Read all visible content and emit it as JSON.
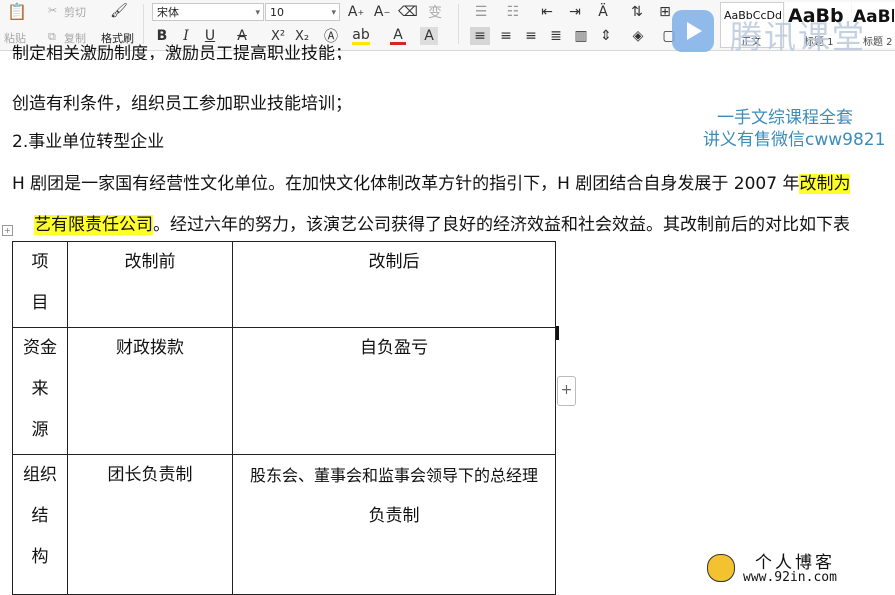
{
  "ribbon": {
    "paste_label": "粘贴",
    "cut_label": "剪切",
    "copy_label": "复制",
    "format_painter_label": "格式刷",
    "font_name": "宋体",
    "font_size": "10",
    "bold": "B",
    "italic": "I",
    "underline": "U",
    "strikethrough": "A",
    "superscript": "X²",
    "subscript": "X₂",
    "styles": [
      {
        "sample": "AaBbCcDd",
        "name": "正文"
      },
      {
        "sample": "AaBb",
        "name": "标题 1"
      },
      {
        "sample": "AaBl",
        "name": "标题 2"
      }
    ]
  },
  "brand": {
    "text": "腾讯课堂"
  },
  "document": {
    "line_partial": "制定相关激励制度，激励员工提高职业技能；",
    "line1": "创造有利条件，组织员工参加职业技能培训；",
    "heading2": "2.事业单位转型企业",
    "para_start": "H 剧团是一家国有经营性文化单位。在加快文化体制改革方针的指引下，H 剧团结合自身发展于 2007 年",
    "para_highlight1": "改制为",
    "para2_highlight": "艺有限责任公司",
    "para2_rest": "。经过六年的努力，该演艺公司获得了良好的经济效益和社会效益。其改制前后的对比如下表"
  },
  "watermark": {
    "line1": "一手文综课程全套",
    "line2": "讲义有售微信cww9821"
  },
  "table": {
    "header": {
      "col1": [
        "项",
        "目"
      ],
      "col2": "改制前",
      "col3": "改制后"
    },
    "rows": [
      {
        "item": [
          "资金",
          "来",
          "源"
        ],
        "before": "财政拨款",
        "after": [
          "自负盈亏"
        ]
      },
      {
        "item": [
          "组织",
          "结",
          "构"
        ],
        "before": "团长负责制",
        "after": [
          "股东会、董事会和监事会领导下的总经理",
          "负责制"
        ]
      }
    ]
  },
  "blog": {
    "title": "个人博客",
    "url": "www.92in.com"
  }
}
